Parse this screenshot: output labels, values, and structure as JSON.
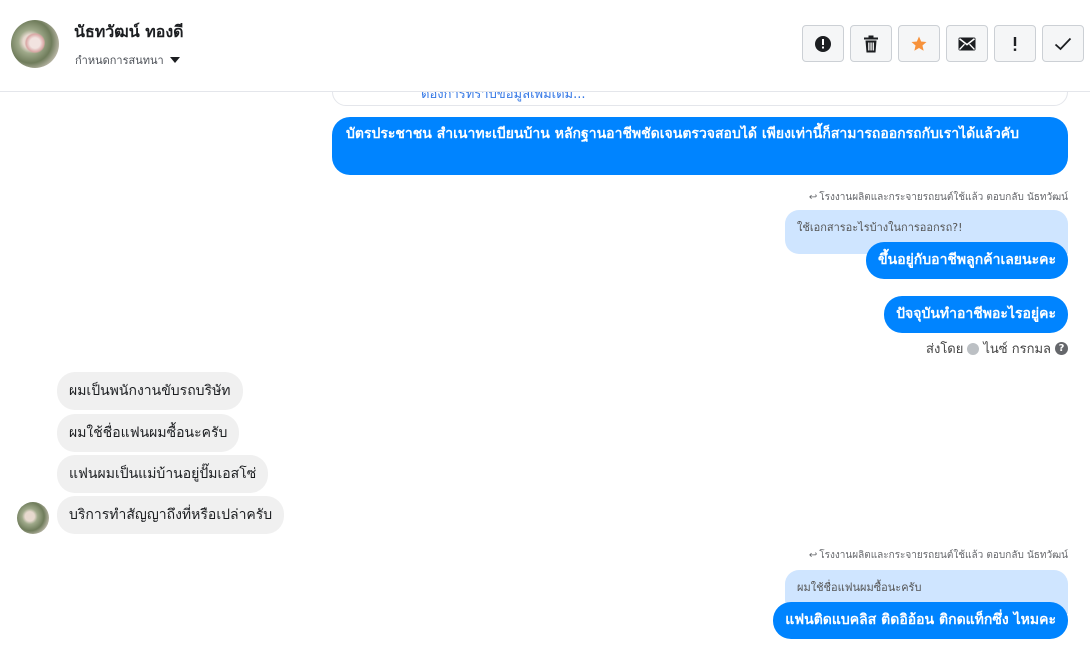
{
  "header": {
    "user_name": "นัธทวัฒน์ ทองดี",
    "settings_label": "กำหนดการสนทนา",
    "toolbar": [
      {
        "name": "report-button",
        "icon": "alert-circle-icon"
      },
      {
        "name": "delete-button",
        "icon": "trash-icon"
      },
      {
        "name": "star-button",
        "icon": "star-icon"
      },
      {
        "name": "mark-unread-button",
        "icon": "envelope-icon"
      },
      {
        "name": "important-button",
        "icon": "exclamation-icon"
      },
      {
        "name": "done-button",
        "icon": "checkmark-icon"
      }
    ]
  },
  "messages": {
    "partial_top": "ต้องการทราบข้อมูลเพิ่มเติม...",
    "out1": "บัตรประชาชน สำเนาทะเบียนบ้าน หลักฐานอาชีพชัดเจนตรวจสอบได้ เพียงเท่านี้ก็สามารถออกรถกับเราได้แล้วคับ",
    "reply_meta1": "โรงงานผลิตและกระจายรถยนต์ใช้แล้ว ตอบกลับ นัธทวัฒน์",
    "quote1": "ใช้เอกสารอะไรบ้างในการออกรถ?!",
    "out2": "ขึ้นอยู่กับอาชีพลูกค้าเลยนะคะ",
    "out3": "ปัจจุบันทำอาชีพอะไรอยู่คะ",
    "sent_by_label": "ส่งโดย",
    "sent_by_name": "ไนซ์ กรกมล",
    "in1": "ผมเป็นพนักงานขับรถบริษัท",
    "in2": "ผมใช้ชื่อแฟนผมซื้อนะครับ",
    "in3": "แฟนผมเป็นแม่บ้านอยู่ปั๊มเอสโซ่",
    "in4": "บริการทำสัญญาถึงที่หรือเปล่าครับ",
    "reply_meta2": "โรงงานผลิตและกระจายรถยนต์ใช้แล้ว ตอบกลับ นัธทวัฒน์",
    "quote2": "ผมใช้ชื่อแฟนผมซื้อนะครับ",
    "out4": "แฟนติดแบคลิส ติดอิอ้อน ติกดแท็กซึ่ง ไหมคะ"
  },
  "colors": {
    "brand_blue": "#0084ff",
    "incoming_bubble": "#f0f0f0",
    "quote_bg": "#cfe5ff",
    "star": "#f7923b"
  }
}
